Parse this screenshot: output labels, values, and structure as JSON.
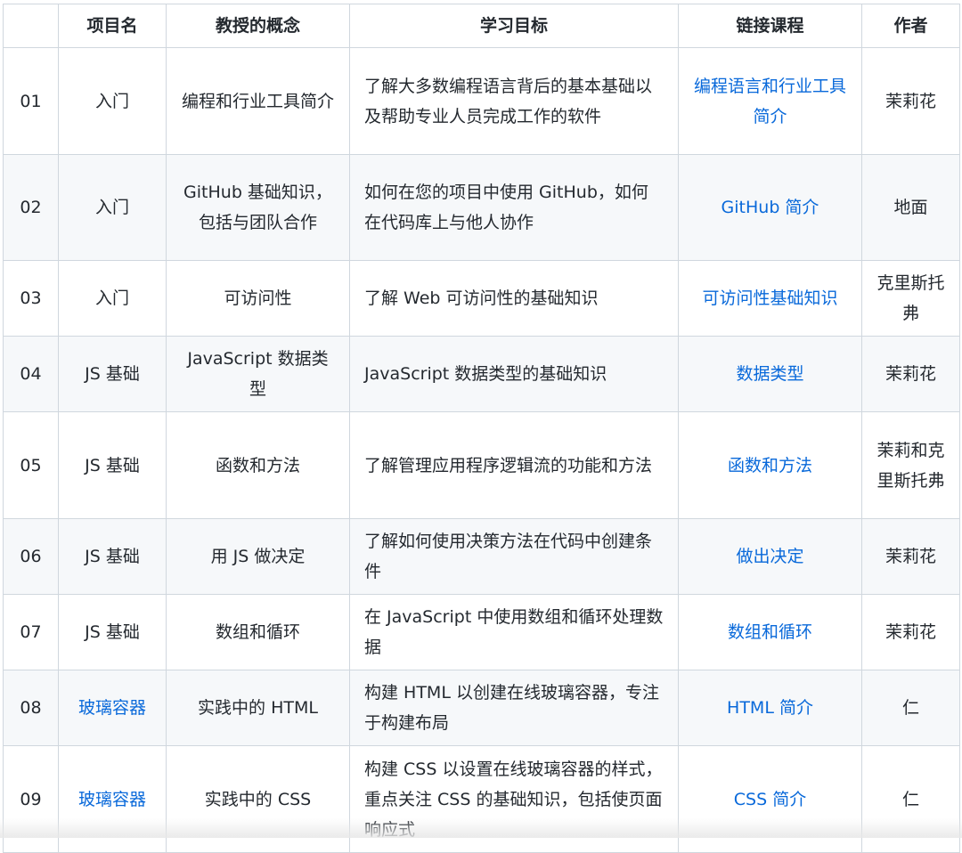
{
  "table": {
    "headers": {
      "number": "",
      "project": "项目名",
      "concept": "教授的概念",
      "goal": "学习目标",
      "lesson": "链接课程",
      "author": "作者"
    },
    "rows": [
      {
        "num": "01",
        "project": "入门",
        "concept": "编程和行业工具简介",
        "goal": "了解大多数编程语言背后的基本基础以及帮助专业人员完成工作的软件",
        "lesson": "编程语言和行业工具简介",
        "author": "茉莉花"
      },
      {
        "num": "02",
        "project": "入门",
        "concept": "GitHub 基础知识，包括与团队合作",
        "goal": "如何在您的项目中使用 GitHub，如何在代码库上与他人协作",
        "lesson": "GitHub 简介",
        "author": "地面"
      },
      {
        "num": "03",
        "project": "入门",
        "concept": "可访问性",
        "goal": "了解 Web 可访问性的基础知识",
        "lesson": "可访问性基础知识",
        "author": "克里斯托弗"
      },
      {
        "num": "04",
        "project": "JS 基础",
        "concept": "JavaScript 数据类型",
        "goal": "JavaScript 数据类型的基础知识",
        "lesson": "数据类型",
        "author": "茉莉花"
      },
      {
        "num": "05",
        "project": "JS 基础",
        "concept": "函数和方法",
        "goal": "了解管理应用程序逻辑流的功能和方法",
        "lesson": "函数和方法",
        "author": "茉莉和克里斯托弗"
      },
      {
        "num": "06",
        "project": "JS 基础",
        "concept": "用 JS 做决定",
        "goal": "了解如何使用决策方法在代码中创建条件",
        "lesson": "做出决定",
        "author": "茉莉花"
      },
      {
        "num": "07",
        "project": "JS 基础",
        "concept": "数组和循环",
        "goal": "在 JavaScript 中使用数组和循环处理数据",
        "lesson": "数组和循环",
        "author": "茉莉花"
      },
      {
        "num": "08",
        "project": "玻璃容器",
        "concept": "实践中的 HTML",
        "goal": "构建 HTML 以创建在线玻璃容器，专注于构建布局",
        "lesson": "HTML 简介",
        "author": "仁"
      },
      {
        "num": "09",
        "project": "玻璃容器",
        "concept": "实践中的 CSS",
        "goal": "构建 CSS 以设置在线玻璃容器的样式，重点关注 CSS 的基础知识，包括使页面响应式",
        "lesson": "CSS 简介",
        "author": "仁"
      }
    ]
  },
  "colors": {
    "link": "#0969da",
    "border": "#d0d7de",
    "stripe": "#f6f8fa",
    "text": "#24292f"
  }
}
